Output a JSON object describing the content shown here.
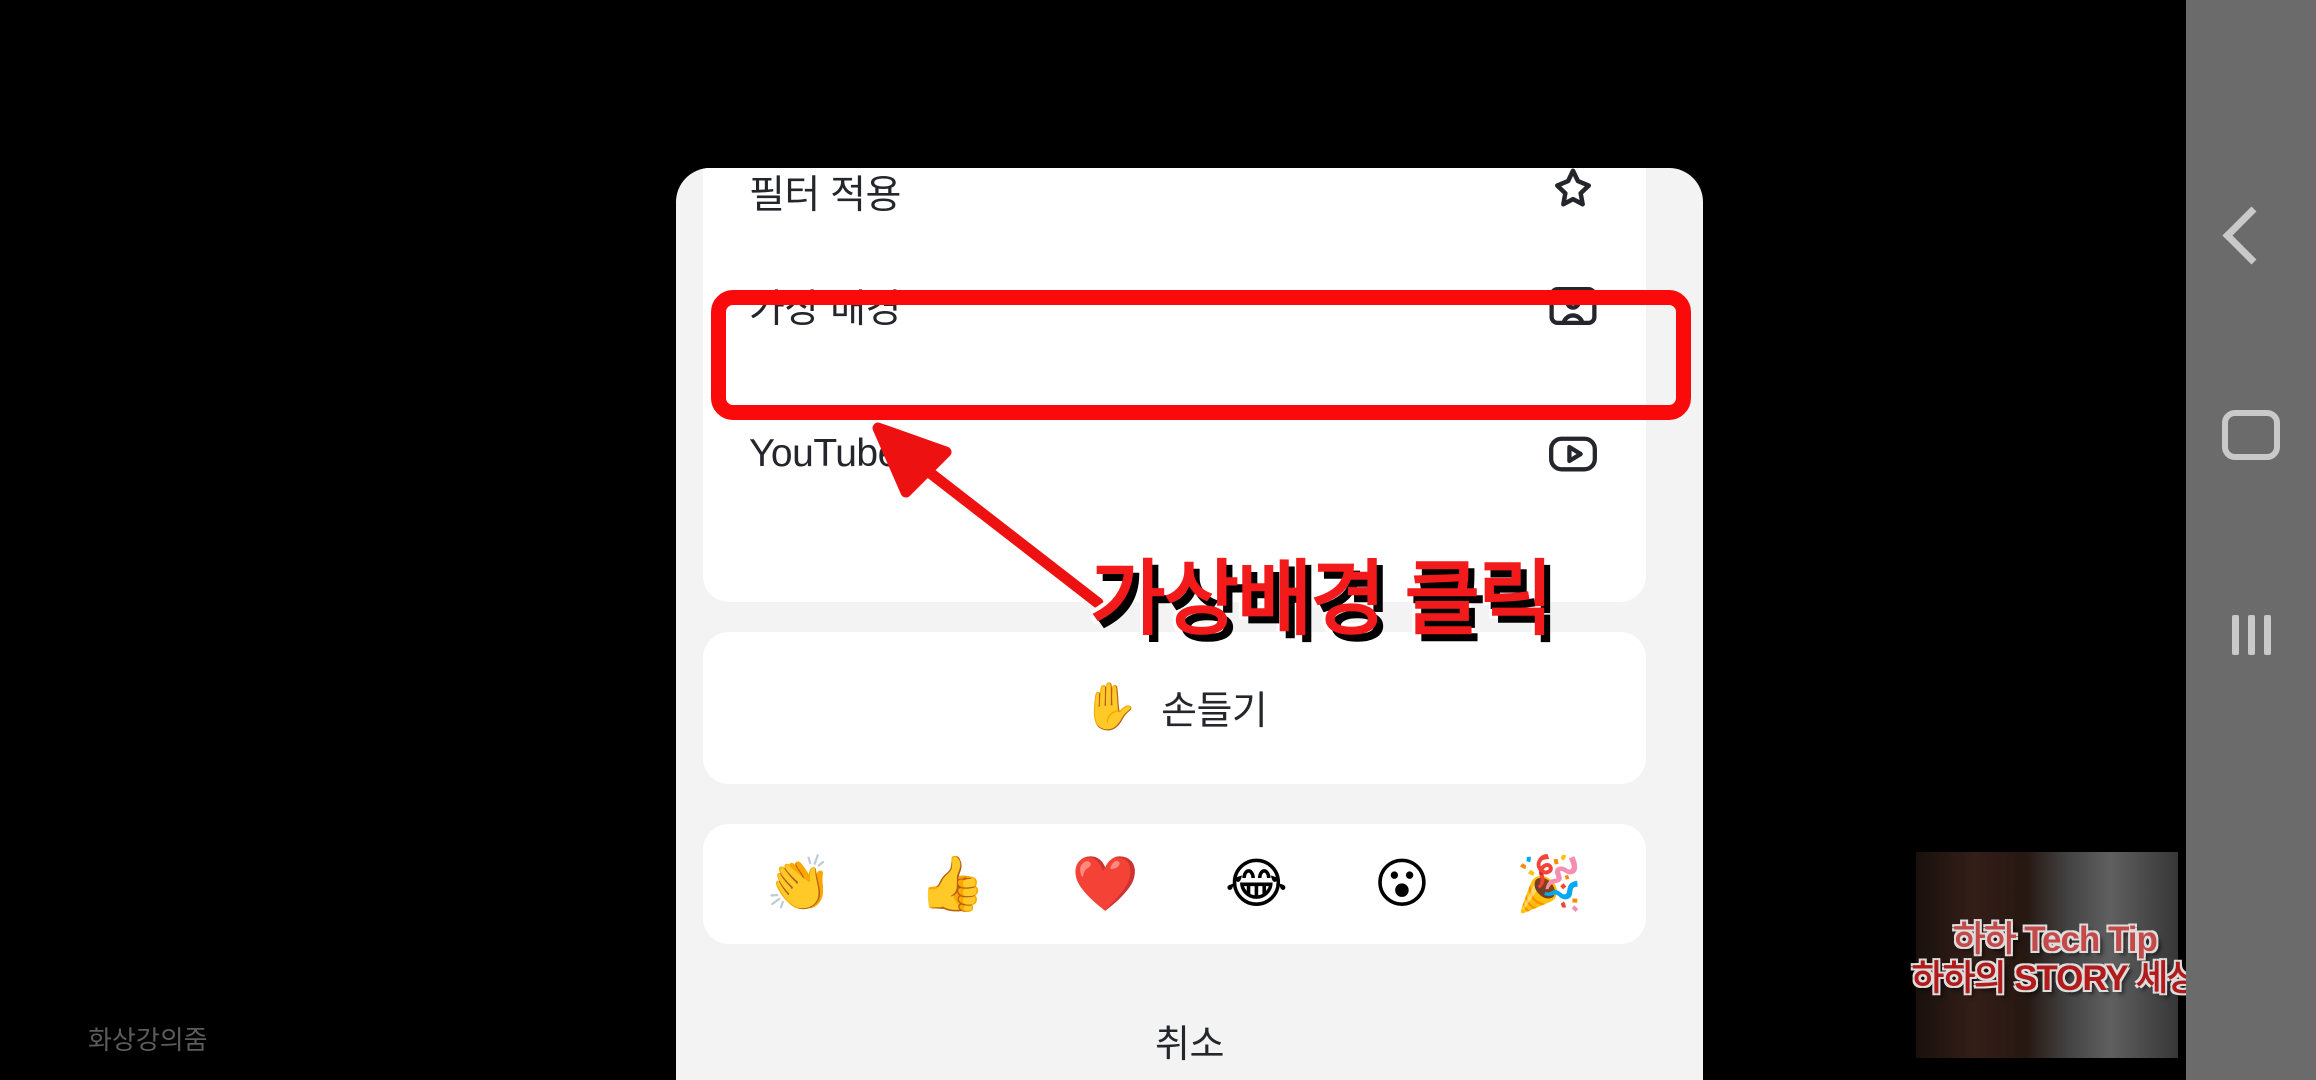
{
  "sheet": {
    "options_card": {
      "rows": [
        {
          "label": "필터 적용",
          "icon": "sparkle-filter-icon",
          "clipped": true
        },
        {
          "label": "가상 배경",
          "icon": "virtual-background-person-icon",
          "clipped": false
        },
        {
          "label": "YouTube",
          "icon": "youtube-play-icon",
          "clipped": false
        }
      ]
    },
    "raise_hand": {
      "emoji": "✋",
      "label": "손들기"
    },
    "reactions": [
      {
        "emoji": "👏",
        "name": "clapping-hands-reaction"
      },
      {
        "emoji": "👍",
        "name": "thumbs-up-reaction"
      },
      {
        "emoji": "❤️",
        "name": "red-heart-reaction"
      },
      {
        "emoji": "😂",
        "name": "joy-laughing-reaction"
      },
      {
        "emoji": "😮",
        "name": "surprised-face-reaction"
      },
      {
        "emoji": "🎉",
        "name": "party-popper-reaction"
      }
    ],
    "cancel_label": "취소"
  },
  "annotation": {
    "caption": "가상배경 클릭",
    "caption_color": "#f21a1a",
    "box_color": "#fa0a0a",
    "arrow_color": "#ee1111"
  },
  "app_label": "화상강의줌",
  "watermark": {
    "line1": "하하 Tech Tip",
    "line2": "하하의 STORY 세상"
  },
  "navbar": {
    "back": "back-button",
    "home": "home-button",
    "recents": "recents-button"
  },
  "colors": {
    "sheet_bg": "#f3f3f4",
    "card_bg": "#ffffff",
    "text": "#25262c",
    "navbar_bg": "#6b6b6b",
    "backdrop": "#000000"
  }
}
